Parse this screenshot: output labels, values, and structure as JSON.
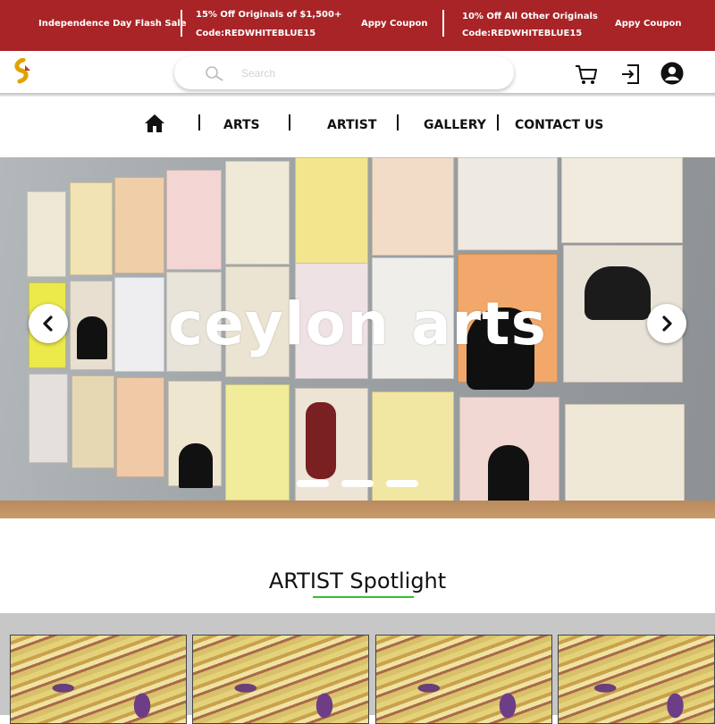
{
  "promo": {
    "headline": "Independence Day Flash Sale",
    "offer1_line1": "15% Off Originals of $1,500+",
    "offer1_line2": "Code:REDWHITEBLUE15",
    "coupon1": "Appy Coupon",
    "offer2_line1": "10% Off All Other Originals",
    "offer2_line2": "Code:REDWHITEBLUE15",
    "coupon2": "Appy Coupon"
  },
  "header": {
    "search_placeholder": "Search",
    "icons": [
      "cart-icon",
      "login-icon",
      "user-icon"
    ]
  },
  "nav": {
    "items": [
      "ARTS",
      "ARTIST",
      "GALLERY",
      "CONTACT US"
    ]
  },
  "hero": {
    "title": "ceylon arts",
    "slides": 3
  },
  "spotlight": {
    "title": "ARTIST Spotlight"
  },
  "colors": {
    "promo_bg": "#a82427",
    "underline": "#2fc22f"
  }
}
